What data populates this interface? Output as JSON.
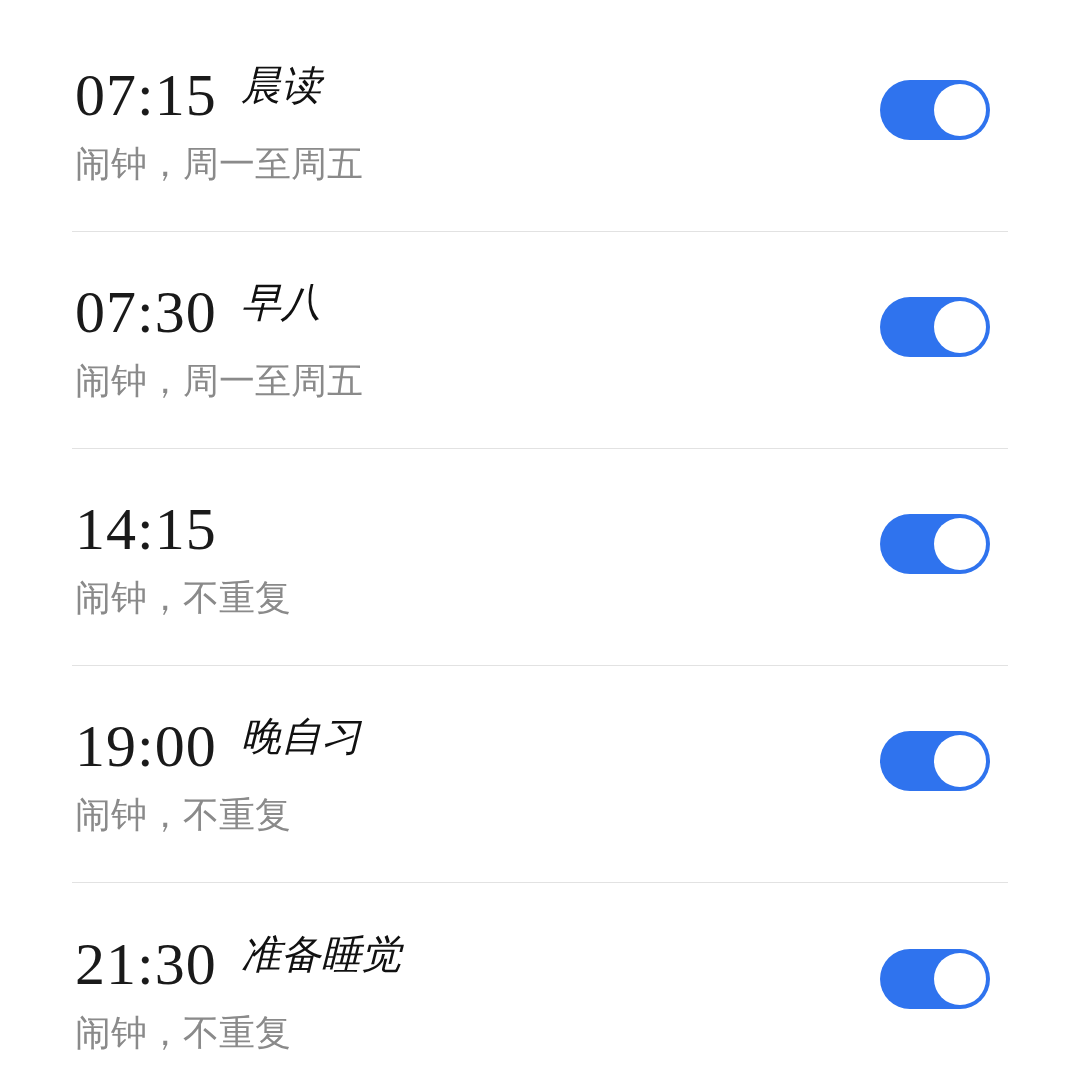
{
  "alarms": [
    {
      "time": "07:15",
      "label": "晨读",
      "repeat": "闹钟，周一至周五",
      "on": true
    },
    {
      "time": "07:30",
      "label": "早八",
      "repeat": "闹钟，周一至周五",
      "on": true
    },
    {
      "time": "14:15",
      "repeat": "闹钟，不重复",
      "on": true
    },
    {
      "time": "19:00",
      "label": "晚自习",
      "repeat": "闹钟，不重复",
      "on": true
    },
    {
      "time": "21:30",
      "label": "准备睡觉",
      "repeat": "闹钟，不重复",
      "on": true
    }
  ]
}
